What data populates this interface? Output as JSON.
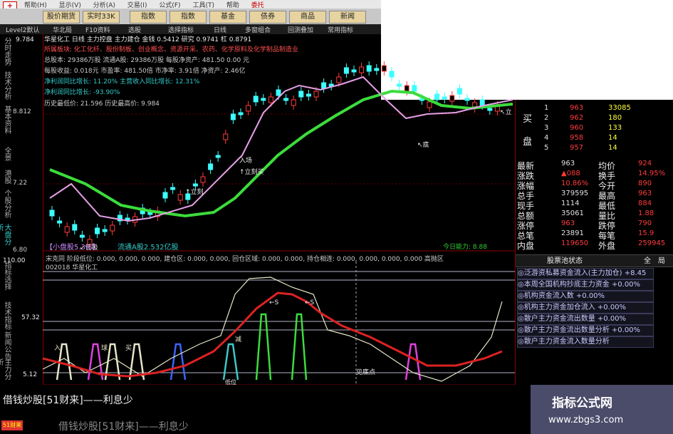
{
  "app": {
    "icon_text": "+"
  },
  "menu": {
    "items": [
      "帮助(H)",
      "显示(V)",
      "分析(A)",
      "交易(I)",
      "公式(F)",
      "工具(T)",
      "帮助",
      "委托"
    ]
  },
  "toolbar": {
    "buttons": [
      "股价期货",
      "实时33K",
      "指数",
      "指数",
      "基金",
      "债券",
      "商品",
      "新闻"
    ]
  },
  "subbar": {
    "items": [
      "Level2默认",
      "华北局",
      "F10资料",
      "选股",
      "选择指标",
      "日线",
      "多窗组合",
      "回测叠加",
      "常用指标"
    ]
  },
  "left_axis": {
    "tabs": [
      "分时走势",
      "技术分析",
      "基本资料",
      "全景",
      "港股",
      "个股分析",
      "大盘分析"
    ],
    "price_labels": [
      "9.784",
      "8.812",
      "7.22",
      "6.80"
    ],
    "osc_labels": [
      "110.00",
      "57.32",
      "5.12"
    ],
    "osc_tabs": [
      "指标选择",
      "技术指标",
      "新闻公告",
      "主力分析"
    ]
  },
  "info": {
    "stock_title": "华星化工 日线  主力控盘  主力建仓  金钱 0.5412  研究 0.9741  杠 0.8791",
    "line1": "所属板块: 化工化纤、股份制板、创业概念、资源开采、农药、化学原料及化学制品制造业",
    "line2": "总股本: 29386万股   流通A股: 29386万股   每股净资产: 481.50  0.00 元",
    "line3": "每股收益: 0.018元   市盈率: 481.50倍   市净率: 3.91倍   净资产: 2.46亿",
    "line4": "净利润同比增长: 11.20%   主营收入同比增长: 12.31%",
    "line5": "净利润同比增长: -93.90%",
    "line6": "历史最低价: 21.596    历史最高价: 9.984",
    "bottom_left": "【小盘股5.3%】",
    "bottom_mid": "流通A股2.532亿股",
    "bottom_right": "今日能力: 8.88"
  },
  "main_chart_annotations": [
    "入场",
    "↑立刻买",
    "↖底",
    "↖立",
    "↑立刻",
    "↙低吸"
  ],
  "lower_header": {
    "line1": "宋克同 阶段低位: 0.000, 0.000, 0.000, 建仓区: 0.000, 0.000, 回仓区域: 0.000, 0.000, 持仓相连: 0.000, 0.000, 0.000, 0.000  高抛区",
    "line2": "002018  华星化工"
  },
  "lower_annotations": {
    "buy1": "入",
    "buy2": "球",
    "buy3": "买",
    "buy4": "减",
    "s1": "←S",
    "s2": "←S",
    "bottom_point": "见底点",
    "low_mark": "低位"
  },
  "orderbook": {
    "side_buy": "买",
    "side_sell": "盘",
    "rows": [
      {
        "n": "1",
        "price": "963",
        "vol": "33085"
      },
      {
        "n": "2",
        "price": "962",
        "vol": "180"
      },
      {
        "n": "3",
        "price": "960",
        "vol": "133"
      },
      {
        "n": "4",
        "price": "958",
        "vol": "14"
      },
      {
        "n": "5",
        "price": "957",
        "vol": "14"
      }
    ]
  },
  "quote": {
    "rows": [
      {
        "l1": "最新",
        "v1": "963",
        "l2": "均价",
        "v2": "924"
      },
      {
        "l1": "涨跌",
        "v1": "▲088",
        "l2": "换手",
        "v2": "14.95%"
      },
      {
        "l1": "涨幅",
        "v1": "10.86%",
        "l2": "今开",
        "v2": "890"
      },
      {
        "l1": "总手",
        "v1": "379595",
        "l2": "最高",
        "v2": "963"
      },
      {
        "l1": "现手",
        "v1": "1114",
        "l2": "最低",
        "v2": "884"
      },
      {
        "l1": "总额",
        "v1": "35061",
        "l2": "量比",
        "v2": "1.88"
      },
      {
        "l1": "涨停",
        "v1": "963",
        "l2": "跌停",
        "v2": "790"
      },
      {
        "l1": "总笔",
        "v1": "23891",
        "l2": "每笔",
        "v2": "15.9"
      },
      {
        "l1": "内盘",
        "v1": "119650",
        "l2": "外盘",
        "v2": "259945"
      }
    ]
  },
  "status": {
    "btn1": "股票池状态",
    "btn2": "全",
    "btn3": "局"
  },
  "funds": [
    "◎泛游资私募资金流入(主力加仓) +8.45",
    "◎本周全国机构抄底主力资金 +0.00%",
    "◎机构资金流入数 +0.00%",
    "◎机构主力资金加仓流入 +0.00%",
    "◎散户主力资金流出数量 +0.00%",
    "◎散户主力资金流出数量分析 +0.00%",
    "◎散户主力资金流入数量分析"
  ],
  "ads": {
    "line1": "借钱炒股[51财来]——利息少",
    "line2": "借钱炒股[51财来]——利息少",
    "logo": "51财来"
  },
  "brand": {
    "title": "指标公式网",
    "url": "www.zbgs3.com"
  },
  "colors": {
    "up": "#ff3c3c",
    "down": "#3cffff",
    "ma_long": "#3cdc3c",
    "ma_short": "#e6a0e6",
    "osc_main": "#d22",
    "osc_line": "#e6e6c8"
  }
}
